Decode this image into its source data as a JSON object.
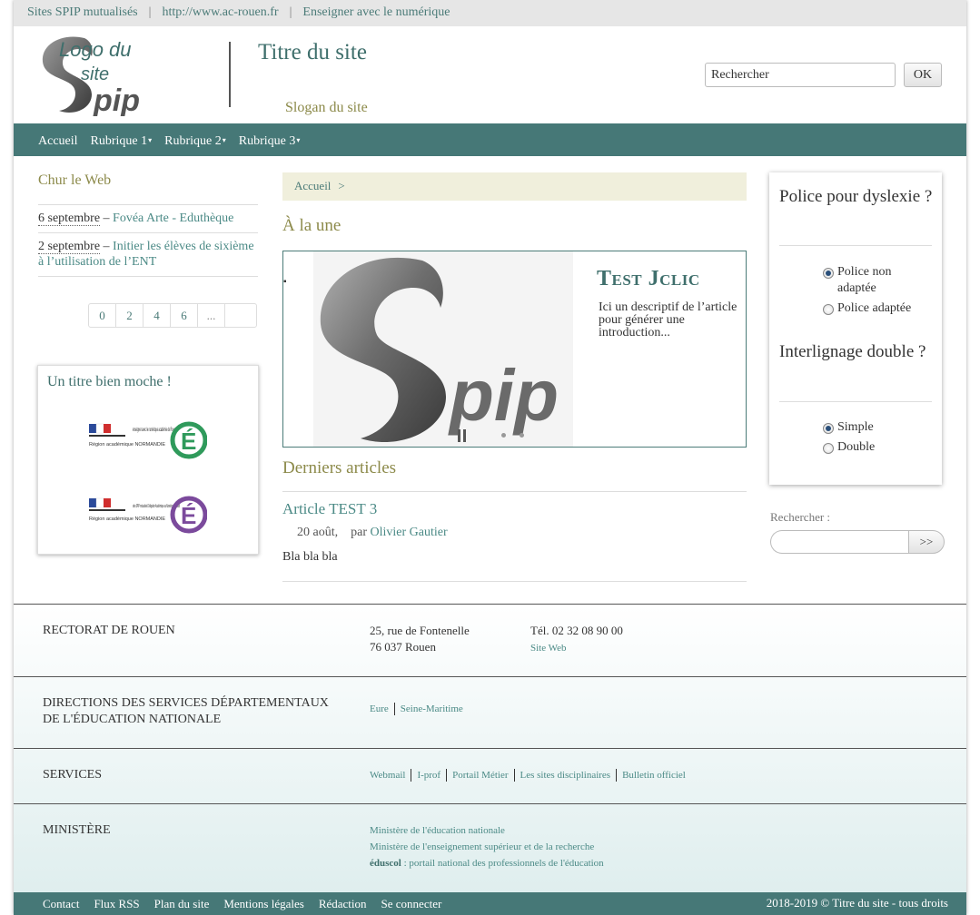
{
  "topbar": {
    "links": [
      "Sites SPIP mutualisés",
      "http://www.ac-rouen.fr",
      "Enseigner avec le numérique"
    ],
    "separator": "|"
  },
  "header": {
    "logo_text_1": "Logo du",
    "logo_text_2": "site",
    "logo_text_3": "pip",
    "title": "Titre du site",
    "slogan": "Slogan du site",
    "search_value": "Rechercher",
    "search_button": "OK"
  },
  "nav": {
    "items": [
      "Accueil",
      "Rubrique 1",
      "Rubrique 2",
      "Rubrique 3"
    ],
    "caret": "▾"
  },
  "left": {
    "title": "Chur le Web",
    "items": [
      {
        "date": "6 septembre",
        "dash": " – ",
        "link": "Fovéa Arte - Eduthèque"
      },
      {
        "date": "2 septembre",
        "dash": " – ",
        "link": "Initier les élèves de sixième à l’utilisation de l’ENT"
      }
    ],
    "pager": [
      "0",
      "2",
      "4",
      "6",
      "..."
    ],
    "widget_title": "Un titre bien moche !",
    "partner1_text": "enseigner avec le numérique académie de Rouen",
    "partner2_text": "sites SPIP mutualisés Délégation Académique au Numérique Éducatif",
    "partner_region": "Région académique NORMANDIE",
    "partner_letter": "É"
  },
  "center": {
    "breadcrumb": "Accueil",
    "breadcrumb_sep": ">",
    "une_heading": "À la une",
    "slide_title": "Test Jclic",
    "slide_desc": "Ici un descriptif de l’article pour générer une introduction...",
    "slide_logo_text": "pip",
    "derniers_heading": "Derniers articles",
    "article_title": "Article TEST 3",
    "article_date": "20 août,",
    "article_by": "par",
    "article_author": "Olivier Gautier",
    "article_text": "Bla bla bla"
  },
  "right": {
    "dyslexie_heading": "Police pour dyslexie ?",
    "dyslexie_options": [
      {
        "label": "Police non adaptée",
        "checked": true
      },
      {
        "label": "Police adaptée",
        "checked": false
      }
    ],
    "interlignage_heading": "Interlignage double ?",
    "interlignage_options": [
      {
        "label": "Simple",
        "checked": true
      },
      {
        "label": "Double",
        "checked": false
      }
    ],
    "search_label": "Rechercher :",
    "search_button": ">>"
  },
  "footer": {
    "rectorat": {
      "title": "RECTORAT DE ROUEN",
      "address1": "25, rue de Fontenelle",
      "address2": "76 037 Rouen",
      "phone": "Tél. 02 32 08 90 00",
      "site": "Site Web"
    },
    "directions": {
      "title1": "DIRECTIONS DES SERVICES DÉPARTEMENTAUX",
      "title2": "DE L'ÉDUCATION NATIONALE",
      "links": [
        "Eure",
        "Seine-Maritime"
      ]
    },
    "services": {
      "title": "SERVICES",
      "links": [
        "Webmail",
        "I-prof",
        "Portail Métier",
        "Les sites disciplinaires",
        "Bulletin officiel"
      ]
    },
    "ministere": {
      "title": "MINISTÈRE",
      "links": [
        "Ministère de l'éducation nationale",
        "Ministère de l'enseignement supérieur et de la recherche"
      ],
      "eduscol_bold": "éduscol",
      "eduscol_rest": " : portail national des professionnels de l'éducation"
    }
  },
  "bottombar": {
    "links": [
      "Contact",
      "Flux RSS",
      "Plan du site",
      "Mentions légales",
      "Rédaction",
      "Se connecter"
    ],
    "copyright": "2018-2019 © Titre du site - tous droits"
  },
  "colors": {
    "teal": "#467877",
    "olive": "#8c8a4a",
    "link": "#4b8a86",
    "breadcrumb_bg": "#f0efdc",
    "eduscol_green": "#2f9a5b",
    "eduscol_purple": "#7b4a9c"
  }
}
